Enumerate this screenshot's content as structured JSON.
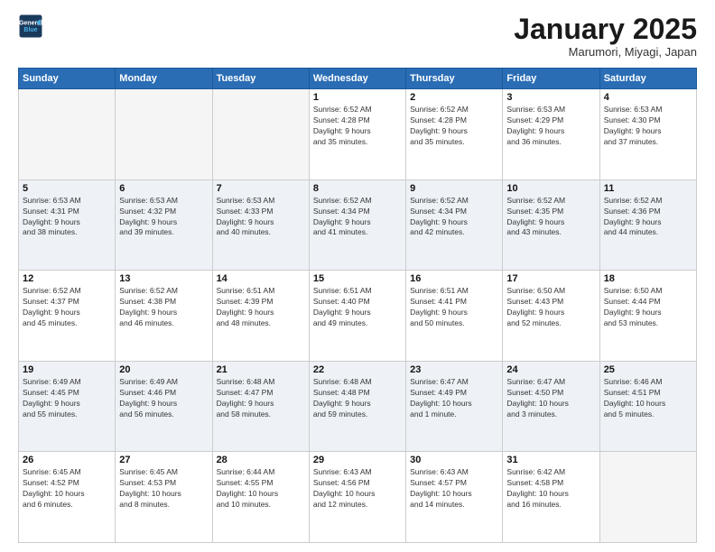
{
  "logo": {
    "line1": "General",
    "line2": "Blue"
  },
  "title": "January 2025",
  "subtitle": "Marumori, Miyagi, Japan",
  "weekdays": [
    "Sunday",
    "Monday",
    "Tuesday",
    "Wednesday",
    "Thursday",
    "Friday",
    "Saturday"
  ],
  "weeks": [
    [
      {
        "day": "",
        "info": ""
      },
      {
        "day": "",
        "info": ""
      },
      {
        "day": "",
        "info": ""
      },
      {
        "day": "1",
        "info": "Sunrise: 6:52 AM\nSunset: 4:28 PM\nDaylight: 9 hours\nand 35 minutes."
      },
      {
        "day": "2",
        "info": "Sunrise: 6:52 AM\nSunset: 4:28 PM\nDaylight: 9 hours\nand 35 minutes."
      },
      {
        "day": "3",
        "info": "Sunrise: 6:53 AM\nSunset: 4:29 PM\nDaylight: 9 hours\nand 36 minutes."
      },
      {
        "day": "4",
        "info": "Sunrise: 6:53 AM\nSunset: 4:30 PM\nDaylight: 9 hours\nand 37 minutes."
      }
    ],
    [
      {
        "day": "5",
        "info": "Sunrise: 6:53 AM\nSunset: 4:31 PM\nDaylight: 9 hours\nand 38 minutes."
      },
      {
        "day": "6",
        "info": "Sunrise: 6:53 AM\nSunset: 4:32 PM\nDaylight: 9 hours\nand 39 minutes."
      },
      {
        "day": "7",
        "info": "Sunrise: 6:53 AM\nSunset: 4:33 PM\nDaylight: 9 hours\nand 40 minutes."
      },
      {
        "day": "8",
        "info": "Sunrise: 6:52 AM\nSunset: 4:34 PM\nDaylight: 9 hours\nand 41 minutes."
      },
      {
        "day": "9",
        "info": "Sunrise: 6:52 AM\nSunset: 4:34 PM\nDaylight: 9 hours\nand 42 minutes."
      },
      {
        "day": "10",
        "info": "Sunrise: 6:52 AM\nSunset: 4:35 PM\nDaylight: 9 hours\nand 43 minutes."
      },
      {
        "day": "11",
        "info": "Sunrise: 6:52 AM\nSunset: 4:36 PM\nDaylight: 9 hours\nand 44 minutes."
      }
    ],
    [
      {
        "day": "12",
        "info": "Sunrise: 6:52 AM\nSunset: 4:37 PM\nDaylight: 9 hours\nand 45 minutes."
      },
      {
        "day": "13",
        "info": "Sunrise: 6:52 AM\nSunset: 4:38 PM\nDaylight: 9 hours\nand 46 minutes."
      },
      {
        "day": "14",
        "info": "Sunrise: 6:51 AM\nSunset: 4:39 PM\nDaylight: 9 hours\nand 48 minutes."
      },
      {
        "day": "15",
        "info": "Sunrise: 6:51 AM\nSunset: 4:40 PM\nDaylight: 9 hours\nand 49 minutes."
      },
      {
        "day": "16",
        "info": "Sunrise: 6:51 AM\nSunset: 4:41 PM\nDaylight: 9 hours\nand 50 minutes."
      },
      {
        "day": "17",
        "info": "Sunrise: 6:50 AM\nSunset: 4:43 PM\nDaylight: 9 hours\nand 52 minutes."
      },
      {
        "day": "18",
        "info": "Sunrise: 6:50 AM\nSunset: 4:44 PM\nDaylight: 9 hours\nand 53 minutes."
      }
    ],
    [
      {
        "day": "19",
        "info": "Sunrise: 6:49 AM\nSunset: 4:45 PM\nDaylight: 9 hours\nand 55 minutes."
      },
      {
        "day": "20",
        "info": "Sunrise: 6:49 AM\nSunset: 4:46 PM\nDaylight: 9 hours\nand 56 minutes."
      },
      {
        "day": "21",
        "info": "Sunrise: 6:48 AM\nSunset: 4:47 PM\nDaylight: 9 hours\nand 58 minutes."
      },
      {
        "day": "22",
        "info": "Sunrise: 6:48 AM\nSunset: 4:48 PM\nDaylight: 9 hours\nand 59 minutes."
      },
      {
        "day": "23",
        "info": "Sunrise: 6:47 AM\nSunset: 4:49 PM\nDaylight: 10 hours\nand 1 minute."
      },
      {
        "day": "24",
        "info": "Sunrise: 6:47 AM\nSunset: 4:50 PM\nDaylight: 10 hours\nand 3 minutes."
      },
      {
        "day": "25",
        "info": "Sunrise: 6:46 AM\nSunset: 4:51 PM\nDaylight: 10 hours\nand 5 minutes."
      }
    ],
    [
      {
        "day": "26",
        "info": "Sunrise: 6:45 AM\nSunset: 4:52 PM\nDaylight: 10 hours\nand 6 minutes."
      },
      {
        "day": "27",
        "info": "Sunrise: 6:45 AM\nSunset: 4:53 PM\nDaylight: 10 hours\nand 8 minutes."
      },
      {
        "day": "28",
        "info": "Sunrise: 6:44 AM\nSunset: 4:55 PM\nDaylight: 10 hours\nand 10 minutes."
      },
      {
        "day": "29",
        "info": "Sunrise: 6:43 AM\nSunset: 4:56 PM\nDaylight: 10 hours\nand 12 minutes."
      },
      {
        "day": "30",
        "info": "Sunrise: 6:43 AM\nSunset: 4:57 PM\nDaylight: 10 hours\nand 14 minutes."
      },
      {
        "day": "31",
        "info": "Sunrise: 6:42 AM\nSunset: 4:58 PM\nDaylight: 10 hours\nand 16 minutes."
      },
      {
        "day": "",
        "info": ""
      }
    ]
  ]
}
